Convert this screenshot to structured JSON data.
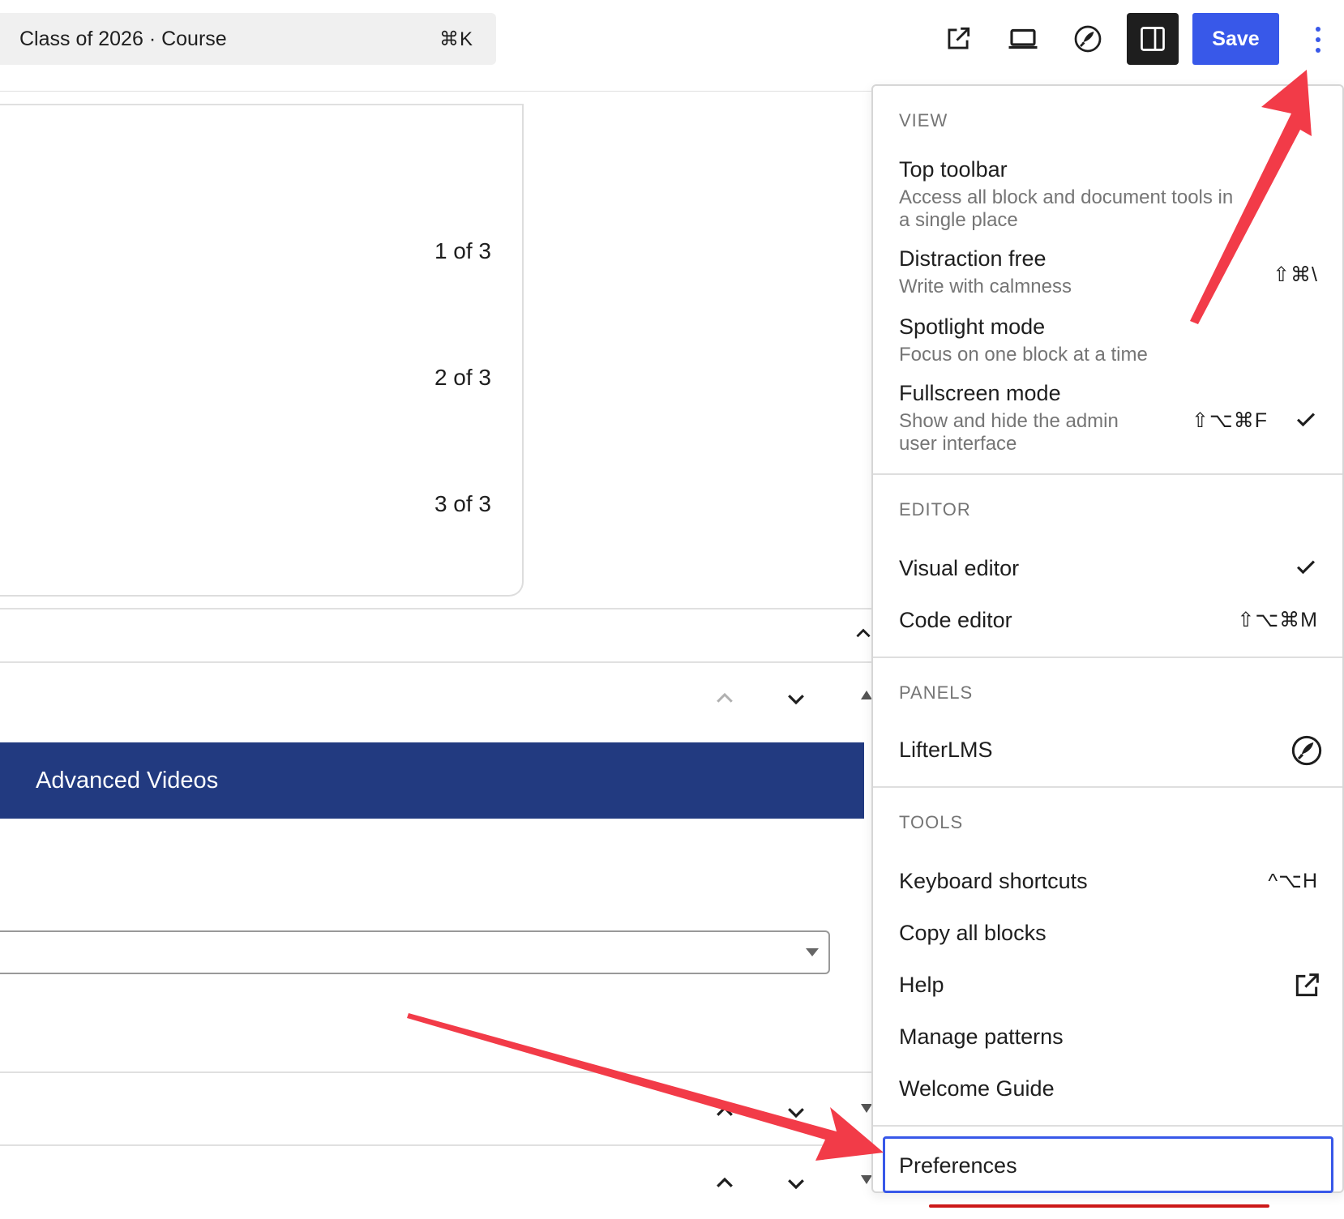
{
  "command_bar": {
    "title": "Class of 2026 · Course",
    "shortcut": "⌘K"
  },
  "toolbar": {
    "icons": [
      "external-link-icon",
      "laptop-icon",
      "lifterlms-rocket-icon",
      "sidebar-toggle-icon"
    ],
    "save_label": "Save"
  },
  "canvas": {
    "slides": [
      "1 of 3",
      "2 of 3",
      "3 of 3"
    ],
    "banner_title": "Advanced Videos"
  },
  "menu": {
    "view": {
      "heading": "VIEW",
      "items": [
        {
          "title": "Top toolbar",
          "desc": "Access all block and document tools in a single place",
          "shortcut": ""
        },
        {
          "title": "Distraction free",
          "desc": "Write with calmness",
          "shortcut": "⇧⌘\\"
        },
        {
          "title": "Spotlight mode",
          "desc": "Focus on one block at a time",
          "shortcut": ""
        },
        {
          "title": "Fullscreen mode",
          "desc": "Show and hide the admin user interface",
          "shortcut": "⇧⌥⌘F",
          "checked": true
        }
      ]
    },
    "editor": {
      "heading": "EDITOR",
      "items": [
        {
          "title": "Visual editor",
          "shortcut": "",
          "checked": true
        },
        {
          "title": "Code editor",
          "shortcut": "⇧⌥⌘M"
        }
      ]
    },
    "panels": {
      "heading": "PANELS",
      "items": [
        {
          "title": "LifterLMS",
          "icon": "lifterlms-rocket-icon"
        }
      ]
    },
    "tools": {
      "heading": "TOOLS",
      "items": [
        {
          "title": "Keyboard shortcuts",
          "shortcut": "^⌥H"
        },
        {
          "title": "Copy all blocks"
        },
        {
          "title": "Help",
          "icon": "external-link-icon"
        },
        {
          "title": "Manage patterns"
        },
        {
          "title": "Welcome Guide"
        }
      ]
    },
    "preferences": {
      "title": "Preferences"
    }
  },
  "colors": {
    "accent": "#3858e9",
    "banner": "#223a80",
    "annotation_arrow": "#f23b48"
  }
}
